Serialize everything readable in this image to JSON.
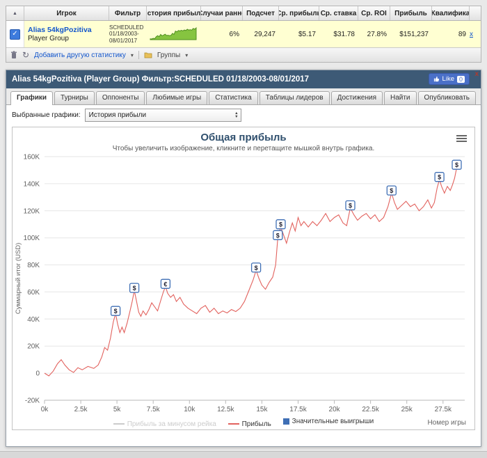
{
  "stats_table": {
    "columns": [
      "Игрок",
      "Фильтр",
      "История прибыли",
      "Случаи ранне",
      "Подсчет",
      "Ср. прибыль",
      "Ср. ставка",
      "Ср. ROI",
      "Прибыль",
      "Квалифика"
    ],
    "row": {
      "player_name": "Alias 54kgPozitiva",
      "player_type": "Player Group",
      "filter": "SCHEDULED 01/18/2003-08/01/2017",
      "sparkline": [
        0,
        -2,
        8,
        2,
        30,
        44,
        30,
        61,
        42,
        52,
        64,
        46,
        50,
        44,
        48,
        76,
        62,
        108,
        96,
        115,
        109,
        118,
        111,
        122,
        114,
        133,
        121,
        127,
        120,
        143,
        133,
        152
      ],
      "early_cases": "6%",
      "count": "29,247",
      "avg_profit": "$5.17",
      "avg_stake": "$31.78",
      "avg_roi": "27.8%",
      "profit": "$151,237",
      "qualification": "89",
      "remove_label": "x"
    },
    "footer": {
      "add_stat_label": "Добавить другую статистику",
      "groups_label": "Группы"
    }
  },
  "panel": {
    "title": "Alias 54kgPozitiva (Player Group) Фильтр:SCHEDULED 01/18/2003-08/01/2017",
    "like_label": "Like",
    "like_count": "0",
    "close_label": "x",
    "tabs": [
      "Графики",
      "Турниры",
      "Оппоненты",
      "Любимые игры",
      "Статистика",
      "Таблицы лидеров",
      "Достижения",
      "Найти",
      "Опубликовать"
    ],
    "selector_label": "Выбранные графики:",
    "selector_value": "История прибыли"
  },
  "chart_data": {
    "type": "line",
    "title": "Общая прибыль",
    "subtitle": "Чтобы увеличить изображение, кликните и перетащите мышкой внутрь графика.",
    "xlabel": "Номер игры",
    "ylabel": "Суммарный итог (USD)",
    "xlim": [
      0,
      29000
    ],
    "ylim": [
      -20000,
      160000
    ],
    "x_tick_values": [
      0,
      2500,
      5000,
      7500,
      10000,
      12500,
      15000,
      17500,
      20000,
      22500,
      25000,
      27500
    ],
    "x_ticks": [
      "0k",
      "2.5k",
      "5k",
      "7.5k",
      "10k",
      "12.5k",
      "15k",
      "17.5k",
      "20k",
      "22.5k",
      "25k",
      "27.5k"
    ],
    "y_tick_values": [
      -20000,
      0,
      20000,
      40000,
      60000,
      80000,
      100000,
      120000,
      140000,
      160000
    ],
    "y_ticks": [
      "-20K",
      "0",
      "20K",
      "40K",
      "60K",
      "80K",
      "100K",
      "120K",
      "140K",
      "160K"
    ],
    "grid": true,
    "legend_position": "bottom",
    "marker_color": "#3f6fb5",
    "legend": [
      {
        "label": "Прибыль за минусом рейка",
        "color": "#cccccc",
        "type": "line",
        "disabled": true
      },
      {
        "label": "Прибыль",
        "color": "#e2625e",
        "type": "line",
        "disabled": false
      },
      {
        "label": "Значительные выигрыши",
        "color": "#3f6fb5",
        "type": "marker",
        "disabled": false
      }
    ],
    "series": [
      {
        "name": "Прибыль",
        "color": "#e2625e",
        "points": [
          [
            0,
            0
          ],
          [
            300,
            -2000
          ],
          [
            600,
            1500
          ],
          [
            900,
            7000
          ],
          [
            1150,
            10000
          ],
          [
            1400,
            6000
          ],
          [
            1700,
            2500
          ],
          [
            2000,
            500
          ],
          [
            2300,
            4000
          ],
          [
            2600,
            2500
          ],
          [
            3000,
            5000
          ],
          [
            3400,
            3500
          ],
          [
            3700,
            6000
          ],
          [
            3950,
            12000
          ],
          [
            4150,
            19000
          ],
          [
            4350,
            17000
          ],
          [
            4550,
            26000
          ],
          [
            4750,
            38000
          ],
          [
            4900,
            44000
          ],
          [
            5050,
            36000
          ],
          [
            5200,
            30000
          ],
          [
            5350,
            34000
          ],
          [
            5500,
            30000
          ],
          [
            5700,
            37000
          ],
          [
            5900,
            46000
          ],
          [
            6050,
            53000
          ],
          [
            6200,
            61000
          ],
          [
            6350,
            53000
          ],
          [
            6500,
            45000
          ],
          [
            6650,
            42000
          ],
          [
            6800,
            46000
          ],
          [
            7000,
            43000
          ],
          [
            7200,
            47000
          ],
          [
            7400,
            52000
          ],
          [
            7600,
            49000
          ],
          [
            7800,
            46000
          ],
          [
            8000,
            53000
          ],
          [
            8200,
            60000
          ],
          [
            8350,
            64000
          ],
          [
            8500,
            59000
          ],
          [
            8700,
            56000
          ],
          [
            8900,
            58000
          ],
          [
            9100,
            53000
          ],
          [
            9350,
            56000
          ],
          [
            9600,
            51000
          ],
          [
            9900,
            48000
          ],
          [
            10200,
            46000
          ],
          [
            10500,
            44000
          ],
          [
            10800,
            48000
          ],
          [
            11100,
            50000
          ],
          [
            11400,
            45000
          ],
          [
            11700,
            48000
          ],
          [
            12000,
            44000
          ],
          [
            12300,
            46000
          ],
          [
            12600,
            44500
          ],
          [
            12900,
            47000
          ],
          [
            13200,
            45500
          ],
          [
            13500,
            48000
          ],
          [
            13800,
            53000
          ],
          [
            14100,
            61000
          ],
          [
            14400,
            69000
          ],
          [
            14600,
            76000
          ],
          [
            14800,
            70000
          ],
          [
            15000,
            65000
          ],
          [
            15250,
            62000
          ],
          [
            15500,
            67000
          ],
          [
            15750,
            71000
          ],
          [
            15950,
            80000
          ],
          [
            16100,
            100000
          ],
          [
            16300,
            108000
          ],
          [
            16500,
            102000
          ],
          [
            16700,
            96000
          ],
          [
            16900,
            104000
          ],
          [
            17100,
            111000
          ],
          [
            17300,
            105000
          ],
          [
            17500,
            115000
          ],
          [
            17700,
            109000
          ],
          [
            17900,
            112000
          ],
          [
            18200,
            108000
          ],
          [
            18500,
            112000
          ],
          [
            18800,
            109000
          ],
          [
            19100,
            113000
          ],
          [
            19400,
            118000
          ],
          [
            19700,
            112000
          ],
          [
            20000,
            115000
          ],
          [
            20300,
            117000
          ],
          [
            20600,
            111000
          ],
          [
            20850,
            109000
          ],
          [
            21100,
            122000
          ],
          [
            21350,
            117000
          ],
          [
            21600,
            113000
          ],
          [
            21900,
            116000
          ],
          [
            22200,
            118000
          ],
          [
            22500,
            114000
          ],
          [
            22800,
            117000
          ],
          [
            23100,
            112000
          ],
          [
            23400,
            115000
          ],
          [
            23700,
            123000
          ],
          [
            23950,
            133000
          ],
          [
            24150,
            126000
          ],
          [
            24350,
            121000
          ],
          [
            24650,
            124000
          ],
          [
            24950,
            127000
          ],
          [
            25250,
            123000
          ],
          [
            25550,
            125000
          ],
          [
            25850,
            120000
          ],
          [
            26150,
            123000
          ],
          [
            26450,
            128000
          ],
          [
            26700,
            122000
          ],
          [
            26900,
            126000
          ],
          [
            27100,
            137000
          ],
          [
            27250,
            143000
          ],
          [
            27400,
            138000
          ],
          [
            27600,
            133000
          ],
          [
            27800,
            138000
          ],
          [
            28000,
            135000
          ],
          [
            28150,
            139000
          ],
          [
            28300,
            144000
          ],
          [
            28450,
            152000
          ]
        ]
      }
    ],
    "markers": [
      {
        "x": 4900,
        "y": 46000,
        "symbol": "$"
      },
      {
        "x": 6200,
        "y": 63000,
        "symbol": "$"
      },
      {
        "x": 8350,
        "y": 66000,
        "symbol": "€"
      },
      {
        "x": 14600,
        "y": 78000,
        "symbol": "$"
      },
      {
        "x": 16100,
        "y": 102000,
        "symbol": "$"
      },
      {
        "x": 16300,
        "y": 110000,
        "symbol": "$"
      },
      {
        "x": 21100,
        "y": 124000,
        "symbol": "$"
      },
      {
        "x": 23950,
        "y": 135000,
        "symbol": "$"
      },
      {
        "x": 27250,
        "y": 145000,
        "symbol": "$"
      },
      {
        "x": 28450,
        "y": 154000,
        "symbol": "$"
      }
    ]
  }
}
